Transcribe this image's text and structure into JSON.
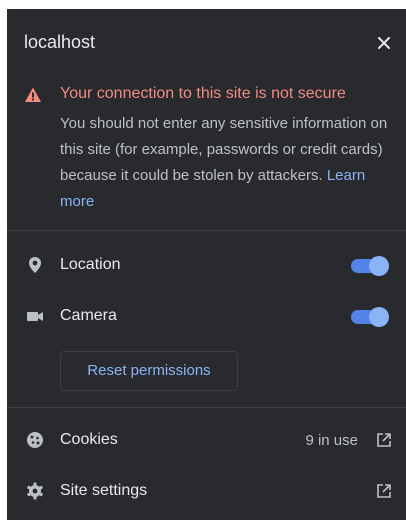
{
  "header": {
    "title": "localhost",
    "close_icon": "close-icon"
  },
  "warning": {
    "icon": "warning-icon",
    "title": "Your connection to this site is not secure",
    "body": "You should not enter any sensitive information on this site (for example, passwords or credit cards) because it could be stolen by attackers.",
    "link": "Learn more",
    "title_color": "#f28b82",
    "link_color": "#8ab4f8"
  },
  "permissions": [
    {
      "icon": "location-pin-icon",
      "label": "Location",
      "enabled": true
    },
    {
      "icon": "camera-icon",
      "label": "Camera",
      "enabled": true
    }
  ],
  "reset_button": {
    "label": "Reset permissions"
  },
  "cookies": {
    "icon": "cookie-icon",
    "label": "Cookies",
    "count": "9 in use"
  },
  "site_settings": {
    "icon": "gear-icon",
    "label": "Site settings"
  },
  "colors": {
    "background": "#292a2d",
    "accent": "#8ab4f8",
    "toggle_track": "#5283e8"
  }
}
